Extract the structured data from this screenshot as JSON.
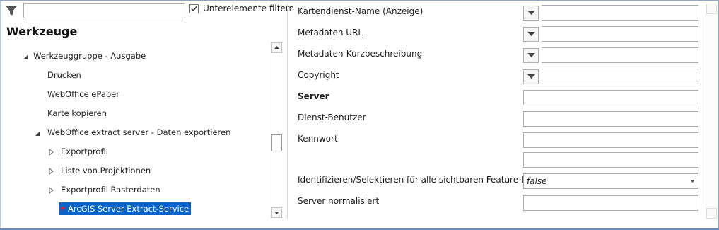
{
  "left_panel": {
    "filter_input_value": "",
    "filter_checkbox_label": "Unterelemente filtern",
    "filter_checkbox_checked": true,
    "title": "Werkzeuge",
    "tree": [
      {
        "label": "Werkzeuggruppe - Ausgabe",
        "expander": "expanded"
      },
      {
        "label": "Drucken",
        "expander": "none"
      },
      {
        "label": "WebOffice ePaper",
        "expander": "none"
      },
      {
        "label": "Karte kopieren",
        "expander": "none"
      },
      {
        "label": "WebOffice extract server - Daten exportieren",
        "expander": "expanded"
      },
      {
        "label": "Exportprofil",
        "expander": "collapsed"
      },
      {
        "label": "Liste von Projektionen",
        "expander": "collapsed"
      },
      {
        "label": "Exportprofil Rasterdaten",
        "expander": "collapsed"
      },
      {
        "label": "ArcGIS Server Extract-Service",
        "expander": "none",
        "selected": true
      }
    ]
  },
  "properties": [
    {
      "label": "Kartendienst-Name (Anzeige)",
      "value": ""
    },
    {
      "label": "Metadaten URL",
      "value": ""
    },
    {
      "label": "Metadaten-Kurzbeschreibung",
      "value": ""
    },
    {
      "label": "Copyright",
      "value": ""
    },
    {
      "label": "Server",
      "value": "",
      "bold": true
    },
    {
      "label": "Dienst-Benutzer",
      "value": ""
    },
    {
      "label": "Kennwort",
      "value": ""
    },
    {
      "label": "Identifizieren/Selektieren für alle sichtbaren Feature-Layer?",
      "value": "false"
    },
    {
      "label": "Server normalisiert",
      "value": ""
    }
  ],
  "icons": {
    "filter": "funnel-icon",
    "dropdown": "triangle-down-icon",
    "expanded": "triangle-expanded-icon",
    "collapsed": "triangle-collapsed-icon",
    "selected_marker": "red-dot-icon"
  },
  "colors": {
    "selection": "#0a63c9",
    "marker": "#e0202a",
    "border": "#6f8fba"
  }
}
